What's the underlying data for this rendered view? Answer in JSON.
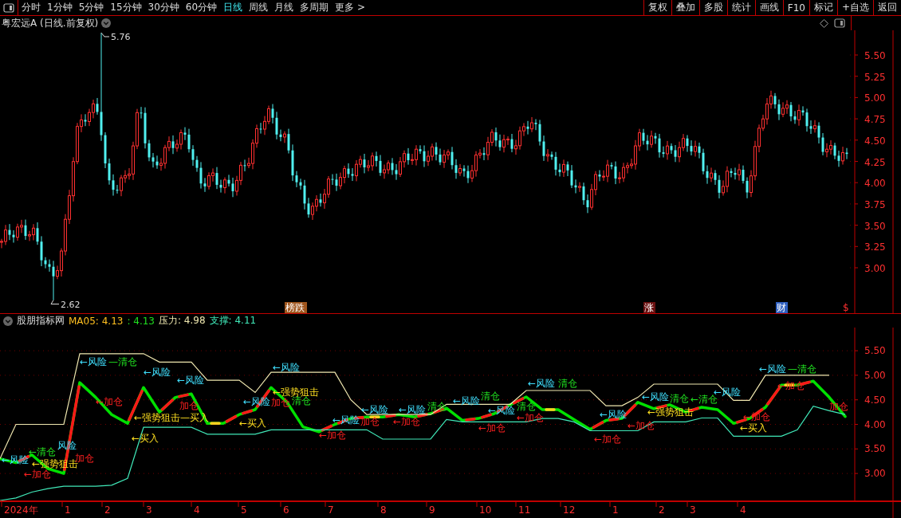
{
  "toolbar": {
    "periods": [
      {
        "label": "分时",
        "selected": false
      },
      {
        "label": "1分钟",
        "selected": false
      },
      {
        "label": "5分钟",
        "selected": false
      },
      {
        "label": "15分钟",
        "selected": false
      },
      {
        "label": "30分钟",
        "selected": false
      },
      {
        "label": "60分钟",
        "selected": false
      },
      {
        "label": "日线",
        "selected": true
      },
      {
        "label": "周线",
        "selected": false
      },
      {
        "label": "月线",
        "selected": false
      },
      {
        "label": "多周期",
        "selected": false
      },
      {
        "label": "更多 >",
        "selected": false
      }
    ],
    "buttons": [
      "复权",
      "叠加",
      "多股",
      "统计",
      "画线",
      "F10",
      "标记",
      "+自选",
      "返回"
    ]
  },
  "price_chart": {
    "title": "粤宏远A (日线.前复权)",
    "high_label": "5.76",
    "low_label": "2.62",
    "yticks": [
      "5.50",
      "5.25",
      "5.00",
      "4.75",
      "4.50",
      "4.25",
      "4.00",
      "3.75",
      "3.50",
      "3.25",
      "3.00"
    ],
    "events": [
      {
        "text": "榜跌",
        "kind": "badge",
        "color": "#a0561e"
      },
      {
        "text": "涨",
        "kind": "badge",
        "color": "#6a1010"
      },
      {
        "text": "财",
        "kind": "badge",
        "color": "#2f5fbf"
      },
      {
        "text": "$",
        "kind": "plain",
        "color": "#ff3030"
      }
    ]
  },
  "indicator": {
    "name": "股朋指标网",
    "values": [
      {
        "text": "MA05: 4.13",
        "color": "#ffc020"
      },
      {
        "text": ": 4.13",
        "color": "#20e020"
      },
      {
        "text": "压力: 4.98",
        "color": "#f0e8b0"
      },
      {
        "text": "支撑: 4.11",
        "color": "#40e8b8"
      }
    ],
    "chart_data": {
      "type": "line",
      "ylim": [
        2.45,
        5.94
      ],
      "yticks": [
        {
          "value": 5.5,
          "label": "5.50"
        },
        {
          "value": 5.0,
          "label": "5.00"
        },
        {
          "value": 4.5,
          "label": "4.50"
        },
        {
          "value": 4.0,
          "label": "4.00"
        },
        {
          "value": 3.5,
          "label": "3.50"
        },
        {
          "value": 3.0,
          "label": "3.00"
        }
      ],
      "grid": true,
      "categories": [
        null,
        null,
        null,
        null,
        null,
        null,
        null,
        null,
        null,
        null,
        null,
        null,
        null,
        null,
        null,
        null,
        null,
        null,
        null,
        null,
        null,
        null,
        null,
        null,
        null,
        null,
        null,
        null,
        null,
        null,
        null,
        null,
        null,
        null,
        null,
        null,
        null,
        null,
        null,
        null,
        null,
        null,
        null,
        null,
        null,
        null,
        null,
        null,
        null,
        null,
        null,
        null,
        null,
        null
      ],
      "series": [
        {
          "color": "#00e000",
          "values": [
            3.3,
            3.22,
            3.38,
            3.1,
            3.0,
            4.85,
            4.55,
            4.2,
            4.02,
            4.75,
            4.25,
            4.55,
            4.62,
            4.02,
            4.02,
            4.2,
            4.3,
            4.75,
            4.45,
            3.95,
            3.85,
            4.0,
            4.12,
            4.15,
            4.15,
            4.2,
            4.15,
            4.22,
            4.33,
            4.08,
            4.12,
            4.22,
            4.4,
            4.56,
            4.3,
            4.3,
            4.1,
            3.9,
            4.08,
            4.12,
            4.45,
            4.32,
            4.4,
            4.25,
            4.35,
            4.3,
            4.02,
            4.12,
            4.35,
            4.8,
            4.8,
            4.88,
            4.55,
            4.16
          ]
        },
        {
          "color": "#f0e8b0",
          "values": [
            3.3,
            4.0,
            4.0,
            4.0,
            4.0,
            5.44,
            5.44,
            5.44,
            5.44,
            5.44,
            5.27,
            5.27,
            5.27,
            4.9,
            4.9,
            4.9,
            4.65,
            5.06,
            5.06,
            5.06,
            5.06,
            5.06,
            4.5,
            4.2,
            4.2,
            4.2,
            4.2,
            4.2,
            4.41,
            4.41,
            4.41,
            4.41,
            4.41,
            4.69,
            4.69,
            4.69,
            4.69,
            4.69,
            4.38,
            4.38,
            4.55,
            4.82,
            4.82,
            4.82,
            4.82,
            4.82,
            4.49,
            4.49,
            5.0,
            5.0,
            5.0,
            5.0,
            5.0,
            null
          ]
        },
        {
          "color": "#40e8b8",
          "values": [
            2.45,
            2.5,
            2.62,
            2.69,
            2.74,
            2.74,
            2.74,
            2.76,
            2.9,
            3.94,
            3.94,
            3.94,
            3.94,
            3.8,
            3.8,
            3.8,
            3.8,
            3.89,
            3.89,
            3.89,
            3.89,
            3.89,
            3.89,
            3.89,
            3.7,
            3.7,
            3.7,
            3.7,
            4.1,
            4.05,
            4.05,
            4.05,
            4.05,
            4.05,
            4.12,
            4.12,
            4.05,
            3.87,
            3.87,
            3.87,
            3.87,
            4.05,
            4.05,
            4.05,
            4.13,
            4.13,
            3.76,
            3.76,
            3.76,
            3.76,
            3.89,
            4.37,
            4.28,
            4.2
          ]
        }
      ]
    },
    "signals": [
      {
        "text": "风险",
        "kind": "risk"
      },
      {
        "text": "←清仓",
        "kind": "clear"
      },
      {
        "text": "←风险",
        "kind": "risk"
      },
      {
        "text": "←强势狙击",
        "kind": "strike"
      },
      {
        "text": "←加仓",
        "kind": "add"
      },
      {
        "text": "←风险",
        "kind": "risk"
      },
      {
        "text": "加仓",
        "kind": "add"
      },
      {
        "text": "—清仓",
        "kind": "clear"
      },
      {
        "text": "←加仓",
        "kind": "add"
      },
      {
        "text": "←风险",
        "kind": "risk"
      },
      {
        "text": "←风险",
        "kind": "risk"
      },
      {
        "text": "加仓",
        "kind": "add"
      },
      {
        "text": "←强势狙击—买入",
        "kind": "strike"
      },
      {
        "text": "←买入",
        "kind": "strike"
      },
      {
        "text": "←风险",
        "kind": "risk"
      },
      {
        "text": "←买入",
        "kind": "strike"
      },
      {
        "text": "←风险",
        "kind": "risk"
      },
      {
        "text": "←强势狙击",
        "kind": "strike"
      },
      {
        "text": "加仓",
        "kind": "add"
      },
      {
        "text": "清仓",
        "kind": "clear"
      },
      {
        "text": "←风险",
        "kind": "risk"
      },
      {
        "text": "←加仓",
        "kind": "add"
      },
      {
        "text": "←风险",
        "kind": "risk"
      },
      {
        "text": "加仓",
        "kind": "add"
      },
      {
        "text": "←风险",
        "kind": "risk"
      },
      {
        "text": "←加仓",
        "kind": "add"
      },
      {
        "text": "清仓",
        "kind": "clear"
      },
      {
        "text": "←风险",
        "kind": "risk"
      },
      {
        "text": "清仓",
        "kind": "clear"
      },
      {
        "text": "←风险",
        "kind": "risk"
      },
      {
        "text": "←加仓",
        "kind": "add"
      },
      {
        "text": "←风险",
        "kind": "risk"
      },
      {
        "text": "清仓",
        "kind": "clear"
      },
      {
        "text": "←加仓",
        "kind": "add"
      },
      {
        "text": "清仓",
        "kind": "clear"
      },
      {
        "text": "←风险",
        "kind": "risk"
      },
      {
        "text": "←加仓",
        "kind": "add"
      },
      {
        "text": "←风险",
        "kind": "risk"
      },
      {
        "text": "清仓",
        "kind": "clear"
      },
      {
        "text": "←清仓",
        "kind": "clear"
      },
      {
        "text": "←强势狙击",
        "kind": "strike"
      },
      {
        "text": "←加仓",
        "kind": "add"
      },
      {
        "text": "←风险",
        "kind": "risk"
      },
      {
        "text": "←风险",
        "kind": "risk"
      },
      {
        "text": "←加仓",
        "kind": "add"
      },
      {
        "text": "←买入",
        "kind": "strike"
      },
      {
        "text": "—清仓",
        "kind": "clear"
      },
      {
        "text": "←加仓",
        "kind": "add"
      },
      {
        "text": "加仓",
        "kind": "add"
      }
    ]
  },
  "date_axis": [
    "2024年",
    "1",
    "2",
    "3",
    "4",
    "5",
    "6",
    "7",
    "8",
    "9",
    "10",
    "11",
    "12",
    "1",
    "2",
    "3",
    "4"
  ]
}
